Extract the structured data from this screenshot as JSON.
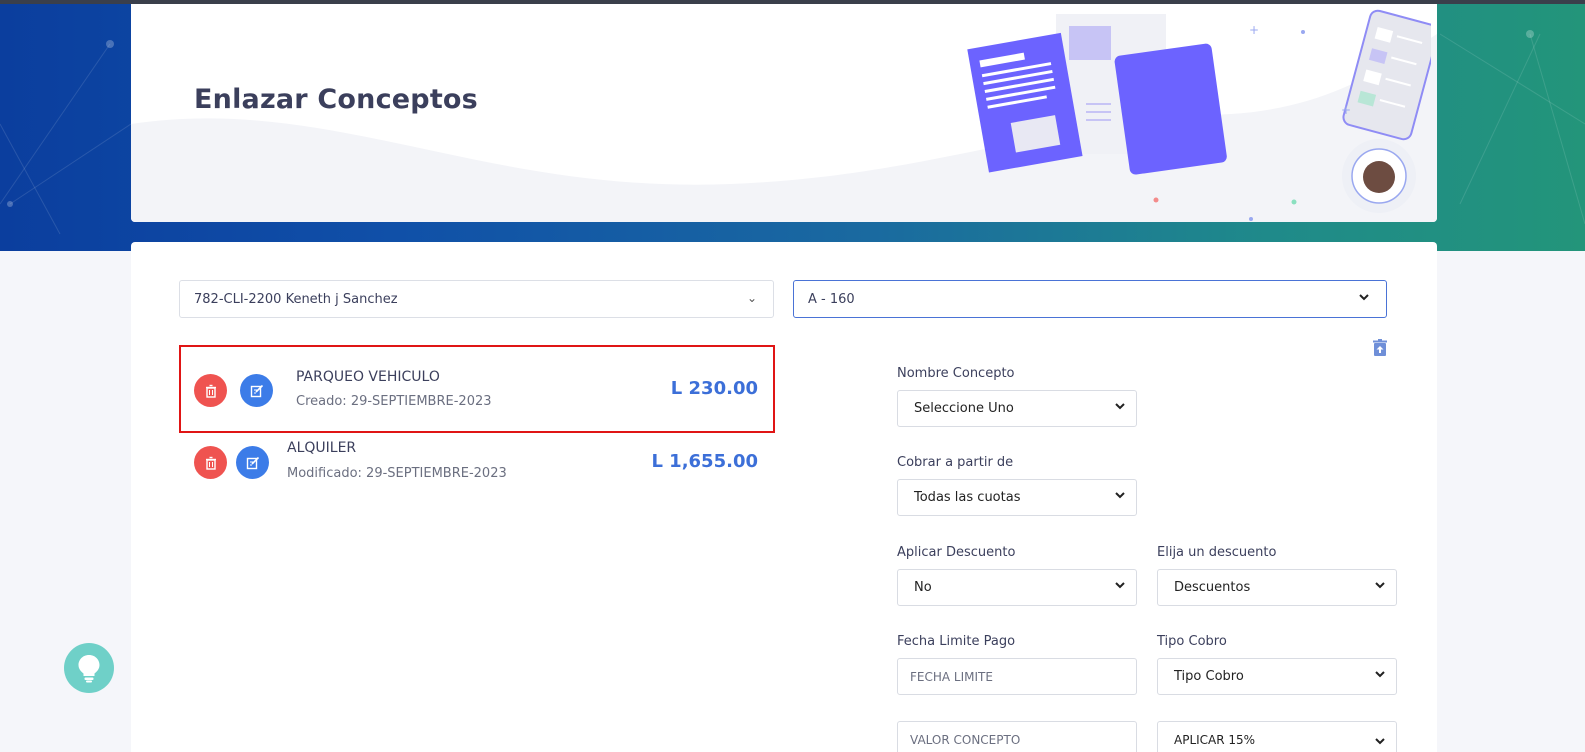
{
  "page": {
    "title": "Enlazar Conceptos"
  },
  "filters": {
    "client_select": "782-CLI-2200 Keneth j Sanchez",
    "unit_select": "A - 160"
  },
  "concepts": [
    {
      "name": "PARQUEO VEHICULO",
      "date": "Creado: 29-SEPTIEMBRE-2023",
      "amount": "L 230.00"
    },
    {
      "name": "ALQUILER",
      "date": "Modificado: 29-SEPTIEMBRE-2023",
      "amount": "L 1,655.00"
    }
  ],
  "form": {
    "nombre_concepto": {
      "label": "Nombre Concepto",
      "value": "Seleccione Uno"
    },
    "cobrar_a_partir": {
      "label": "Cobrar a partir de",
      "value": "Todas las cuotas"
    },
    "aplicar_descuento": {
      "label": "Aplicar Descuento",
      "value": "No"
    },
    "elija_descuento": {
      "label": "Elija un descuento",
      "value": "Descuentos"
    },
    "fecha_limite": {
      "label": "Fecha Limite Pago",
      "placeholder": "FECHA LIMITE"
    },
    "tipo_cobro": {
      "label": "Tipo Cobro",
      "value": "Tipo Cobro"
    },
    "valor_concepto": {
      "placeholder": "VALOR CONCEPTO"
    },
    "impuesto": {
      "value": "APLICAR 15%"
    }
  },
  "colors": {
    "accent": "#3c6fd8",
    "danger": "#ef5350",
    "primary_button": "#3c7ce8",
    "highlight": "#e01515",
    "help": "#6fd0c8"
  },
  "icons": {
    "delete": "trash-icon",
    "edit": "edit-icon",
    "clear": "trash-upload-icon",
    "help": "lightbulb-icon",
    "dropdown": "chevron-down-icon"
  }
}
